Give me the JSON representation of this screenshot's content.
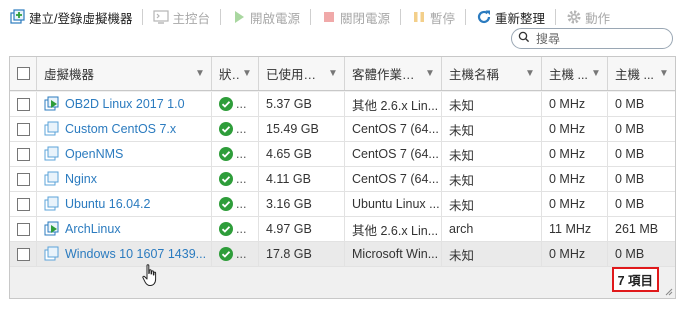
{
  "toolbar": {
    "create": "建立/登錄虛擬機器",
    "console": "主控台",
    "power_on": "開啟電源",
    "power_off": "關閉電源",
    "suspend": "暫停",
    "refresh": "重新整理",
    "actions": "動作"
  },
  "search": {
    "placeholder": "搜尋"
  },
  "columns": {
    "name": "虛擬機器",
    "status": "狀 ...",
    "used_space": "已使用空間",
    "guest_os": "客體作業系統",
    "host_name": "主機名稱",
    "host_cpu": "主機 ...",
    "host_mem": "主機 ..."
  },
  "rows": [
    {
      "name": "OB2D Linux 2017 1.0",
      "status": "...",
      "used": "5.37 GB",
      "os": "其他 2.6.x Lin...",
      "host": "未知",
      "cpu": "0 MHz",
      "mem": "0 MB",
      "powered": true
    },
    {
      "name": "Custom CentOS 7.x",
      "status": "...",
      "used": "15.49 GB",
      "os": "CentOS 7 (64...",
      "host": "未知",
      "cpu": "0 MHz",
      "mem": "0 MB",
      "powered": false
    },
    {
      "name": "OpenNMS",
      "status": "...",
      "used": "4.65 GB",
      "os": "CentOS 7 (64...",
      "host": "未知",
      "cpu": "0 MHz",
      "mem": "0 MB",
      "powered": false
    },
    {
      "name": "Nginx",
      "status": "...",
      "used": "4.11 GB",
      "os": "CentOS 7 (64...",
      "host": "未知",
      "cpu": "0 MHz",
      "mem": "0 MB",
      "powered": false
    },
    {
      "name": "Ubuntu 16.04.2",
      "status": "...",
      "used": "3.16 GB",
      "os": "Ubuntu Linux ...",
      "host": "未知",
      "cpu": "0 MHz",
      "mem": "0 MB",
      "powered": false
    },
    {
      "name": "ArchLinux",
      "status": "...",
      "used": "4.97 GB",
      "os": "其他 2.6.x Lin...",
      "host": "arch",
      "cpu": "11 MHz",
      "mem": "261 MB",
      "powered": true
    },
    {
      "name": "Windows 10 1607 1439...",
      "status": "...",
      "used": "17.8 GB",
      "os": "Microsoft Win...",
      "host": "未知",
      "cpu": "0 MHz",
      "mem": "0 MB",
      "powered": false
    }
  ],
  "footer": {
    "count": "7 項目"
  },
  "colors": {
    "link": "#2b7bbf",
    "ok": "#2e9d3a",
    "highlight": "#e0191b"
  }
}
